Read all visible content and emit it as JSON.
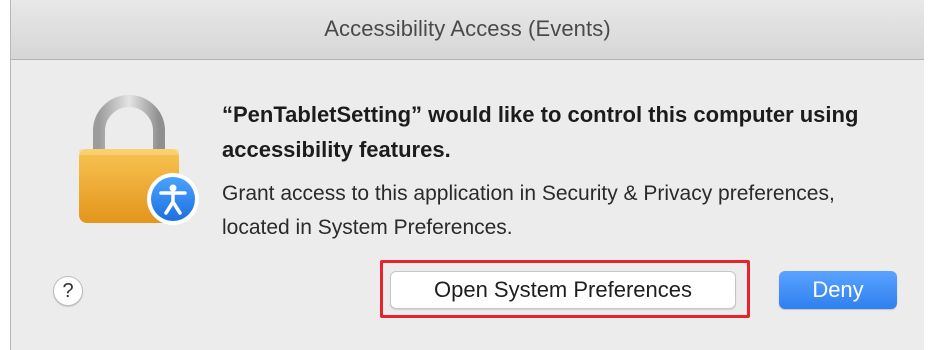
{
  "dialog": {
    "title": "Accessibility Access (Events)",
    "headline": "“PenTabletSetting” would like to control this computer using accessibility features.",
    "body": "Grant access to this application in Security & Privacy preferences, located in System Preferences.",
    "help_label": "?",
    "open_preferences_label": "Open System Preferences",
    "deny_label": "Deny"
  },
  "icons": {
    "lock": "lock-icon",
    "accessibility_badge": "accessibility-icon"
  },
  "colors": {
    "accent": "#2f7ff0",
    "highlight": "#e8232a",
    "lock_body": "#f3aa2c"
  }
}
